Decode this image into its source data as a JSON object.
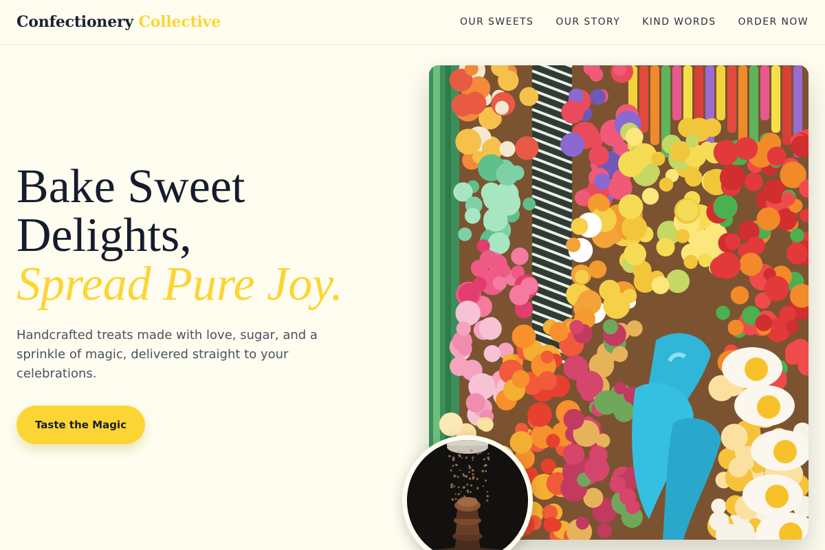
{
  "nav": {
    "brand_main": "Confectionery",
    "brand_accent": "Collective",
    "links": [
      "OUR SWEETS",
      "OUR STORY",
      "KIND WORDS",
      "ORDER NOW"
    ]
  },
  "hero": {
    "title_line1": "Bake Sweet",
    "title_line2": "Delights,",
    "title_accent": "Spread Pure Joy.",
    "subtitle": "Handcrafted treats made with love, sugar, and a sprinkle of magic, delivered straight to your celebrations.",
    "cta_label": "Taste the Magic"
  },
  "images": {
    "main": "candy-assortment-photo",
    "inset": "cupcake-stack-photo"
  },
  "colors": {
    "accent": "#fcd535",
    "background": "#fefdf0",
    "heading": "#151c2c",
    "body_text": "#4a5160"
  }
}
